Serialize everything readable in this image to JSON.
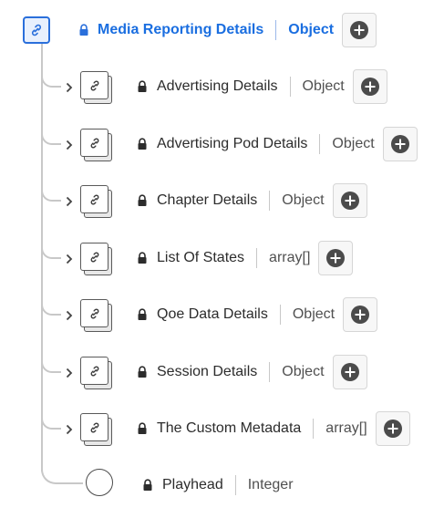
{
  "root": {
    "name": "Media Reporting Details",
    "type": "Object"
  },
  "children": [
    {
      "name": "Advertising Details",
      "type": "Object"
    },
    {
      "name": "Advertising Pod Details",
      "type": "Object"
    },
    {
      "name": "Chapter Details",
      "type": "Object"
    },
    {
      "name": "List Of States",
      "type": "array[]"
    },
    {
      "name": "Qoe Data Details",
      "type": "Object"
    },
    {
      "name": "Session Details",
      "type": "Object"
    },
    {
      "name": "The Custom Metadata",
      "type": "array[]"
    }
  ],
  "leaf": {
    "name": "Playhead",
    "type": "Integer"
  },
  "colors": {
    "accent": "#1a6ee0",
    "line": "#c8c8c8"
  }
}
